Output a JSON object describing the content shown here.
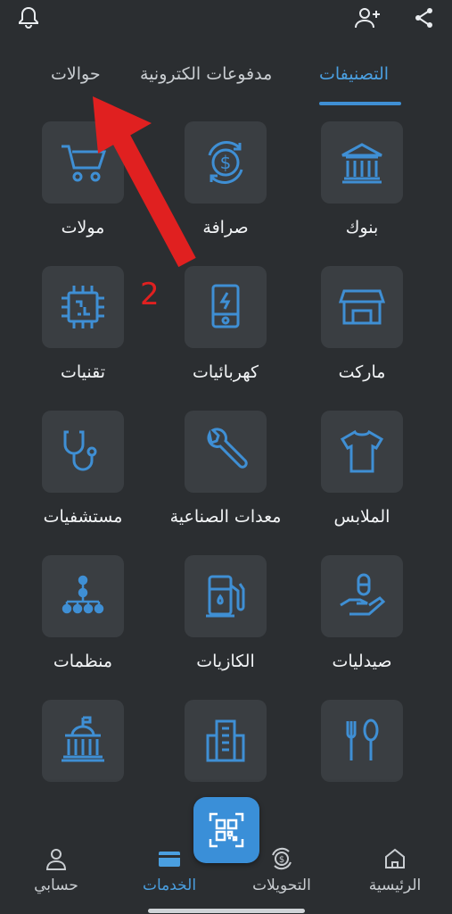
{
  "tabs": [
    {
      "label": "التصنيفات",
      "active": true
    },
    {
      "label": "مدفوعات الكترونية",
      "active": false
    },
    {
      "label": "حوالات",
      "active": false
    }
  ],
  "categories": [
    {
      "label": "بنوك",
      "icon": "bank-icon"
    },
    {
      "label": "صرافة",
      "icon": "currency-exchange-icon"
    },
    {
      "label": "مولات",
      "icon": "shopping-cart-icon"
    },
    {
      "label": "ماركت",
      "icon": "store-icon"
    },
    {
      "label": "كهربائيات",
      "icon": "electric-device-icon"
    },
    {
      "label": "تقنيات",
      "icon": "chip-icon"
    },
    {
      "label": "الملابس",
      "icon": "shirt-icon"
    },
    {
      "label": "معدات الصناعية",
      "icon": "wrench-icon"
    },
    {
      "label": "مستشفيات",
      "icon": "stethoscope-icon"
    },
    {
      "label": "صيدليات",
      "icon": "pharmacy-hand-pill-icon"
    },
    {
      "label": "الكازيات",
      "icon": "fuel-pump-icon"
    },
    {
      "label": "منظمات",
      "icon": "organization-tree-icon"
    },
    {
      "label": "",
      "icon": "restaurant-icon"
    },
    {
      "label": "",
      "icon": "building-icon"
    },
    {
      "label": "",
      "icon": "government-building-icon"
    }
  ],
  "bottom_nav": [
    {
      "label": "الرئيسية",
      "icon": "home-icon",
      "active": false
    },
    {
      "label": "التحويلات",
      "icon": "transfer-icon",
      "active": false
    },
    {
      "label": "الخدمات",
      "icon": "card-icon",
      "active": true
    },
    {
      "label": "حسابي",
      "icon": "user-icon",
      "active": false
    }
  ],
  "annotation": {
    "number": "2"
  },
  "colors": {
    "background": "#2b2e31",
    "tile": "#3a3e42",
    "accent": "#3f8fd4",
    "arrow": "#e02020"
  }
}
